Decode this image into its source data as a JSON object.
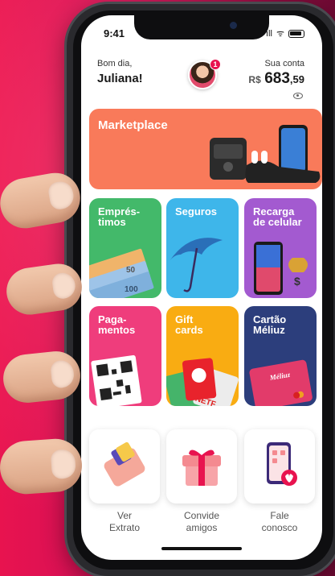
{
  "status_bar": {
    "time": "9:41",
    "signal": "ıll",
    "wifi": "ᯤ"
  },
  "header": {
    "greeting": "Bom dia,",
    "user_name": "Juliana!",
    "notification_count": "1",
    "balance_label": "Sua conta",
    "currency": "R$",
    "balance_int": "683",
    "balance_dec": ",59"
  },
  "tiles": {
    "marketplace": "Marketplace",
    "emprestimos": "Emprés-\ntimos",
    "seguros": "Seguros",
    "recarga": "Recarga\nde celular",
    "pagamentos": "Paga-\nmentos",
    "gift": "Gift\ncards",
    "cartao": "Cartão\nMéliuz",
    "cash_note": "100",
    "cash_note_50": "50",
    "card_brand": "Méliuz",
    "gift_brand": "NETF"
  },
  "actions": [
    {
      "line1": "Ver",
      "line2": "Extrato"
    },
    {
      "line1": "Convide",
      "line2": "amigos"
    },
    {
      "line1": "Fale",
      "line2": "conosco"
    }
  ],
  "colors": {
    "marketplace": "#f97a5a",
    "emprestimos": "#43b96a",
    "seguros": "#3eb6ea",
    "recarga": "#a35ad0",
    "pagamentos": "#ef3d7c",
    "gift": "#f9ac12",
    "cartao": "#2c3e7c",
    "accent": "#e8134f"
  }
}
